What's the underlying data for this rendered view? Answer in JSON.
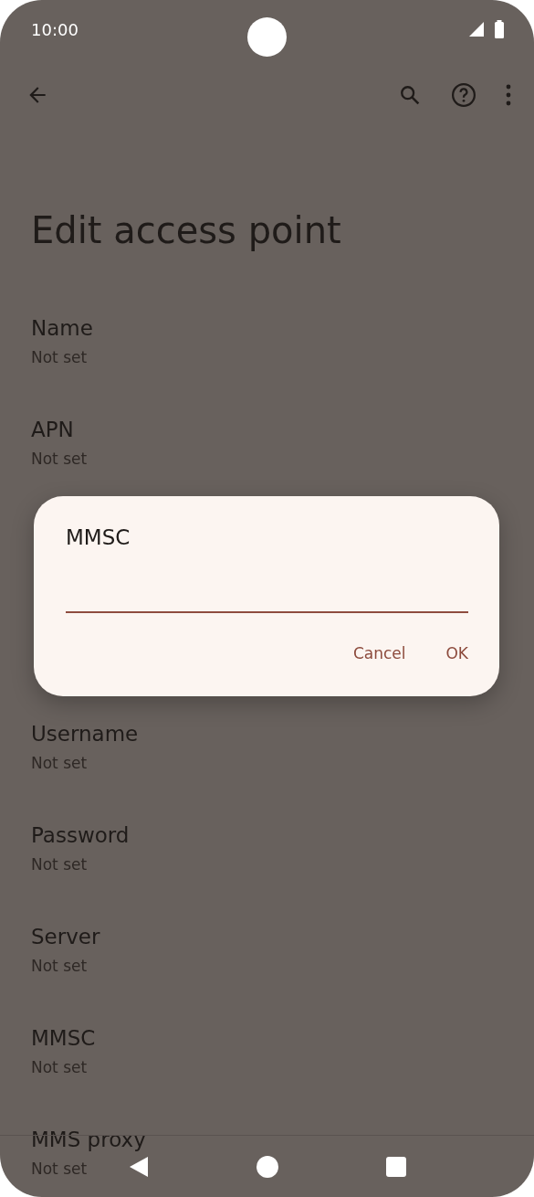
{
  "status_bar": {
    "time": "10:00"
  },
  "app_bar": {
    "actions": [
      {
        "kind": "search"
      },
      {
        "kind": "help"
      },
      {
        "kind": "more"
      }
    ]
  },
  "title": "Edit access point",
  "settings_top": [
    {
      "label": "Name",
      "value": "Not set"
    },
    {
      "label": "APN",
      "value": "Not set"
    }
  ],
  "settings_bottom": [
    {
      "label": "Username",
      "value": "Not set"
    },
    {
      "label": "Password",
      "value": "Not set"
    },
    {
      "label": "Server",
      "value": "Not set"
    },
    {
      "label": "MMSC",
      "value": "Not set"
    },
    {
      "label": "MMS proxy",
      "value": "Not set"
    }
  ],
  "dialog": {
    "title": "MMSC",
    "buttons": [
      "Cancel",
      "OK"
    ]
  },
  "nav_bar": {
    "buttons": [
      {
        "kind": "back"
      },
      {
        "kind": "home"
      },
      {
        "kind": "recents"
      }
    ]
  }
}
